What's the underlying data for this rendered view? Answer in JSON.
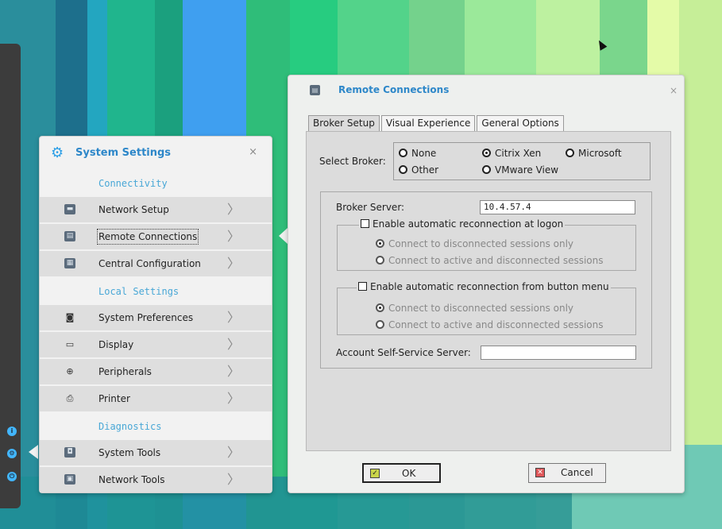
{
  "colors": {
    "accent": "#2d87c9",
    "section_heading": "#48a7d6",
    "panel_bg": "#f2f2f2",
    "menu_item_bg": "#dedede",
    "dock_icon": "#42b6ff"
  },
  "system_settings": {
    "title": "System Settings",
    "close_glyph": "×",
    "sections": [
      {
        "heading": "Connectivity",
        "items": [
          {
            "label": "Network Setup",
            "icon": "network-setup-icon",
            "glyph": "▬",
            "chevron": "〉"
          },
          {
            "label": "Remote Connections",
            "icon": "remote-connections-icon",
            "glyph": "▤",
            "chevron": "〉"
          },
          {
            "label": "Central Configuration",
            "icon": "central-configuration-icon",
            "glyph": "▦",
            "chevron": "〉"
          }
        ]
      },
      {
        "heading": "Local Settings",
        "items": [
          {
            "label": "System Preferences",
            "icon": "system-preferences-icon",
            "glyph": "◙",
            "chevron": "〉"
          },
          {
            "label": "Display",
            "icon": "display-icon",
            "glyph": "▭",
            "chevron": "〉"
          },
          {
            "label": "Peripherals",
            "icon": "mouse-icon",
            "glyph": "⊕",
            "chevron": "〉"
          },
          {
            "label": "Printer",
            "icon": "printer-icon",
            "glyph": "⎙",
            "chevron": "〉"
          }
        ]
      },
      {
        "heading": "Diagnostics",
        "items": [
          {
            "label": "System Tools",
            "icon": "system-tools-icon",
            "glyph": "◘",
            "chevron": "〉"
          },
          {
            "label": "Network Tools",
            "icon": "network-tools-icon",
            "glyph": "▣",
            "chevron": "〉"
          }
        ]
      }
    ]
  },
  "dialog": {
    "title": "Remote Connections",
    "close_glyph": "×",
    "tabs": [
      "Broker Setup",
      "Visual Experience",
      "General Options"
    ],
    "active_tab": "Broker Setup",
    "select_broker_label": "Select Broker:",
    "broker_options": [
      {
        "label": "None",
        "selected": false
      },
      {
        "label": "Citrix Xen",
        "selected": true
      },
      {
        "label": "Microsoft",
        "selected": false
      },
      {
        "label": "Other",
        "selected": false
      },
      {
        "label": "VMware View",
        "selected": false
      }
    ],
    "broker_server_label": "Broker Server:",
    "broker_server_value": "10.4.57.4",
    "group_logon": {
      "checkbox_label": "Enable automatic reconnection at logon",
      "checked": false,
      "options": [
        {
          "label": "Connect to disconnected sessions only",
          "selected": true
        },
        {
          "label": "Connect to active and disconnected sessions",
          "selected": false
        }
      ]
    },
    "group_button": {
      "checkbox_label": "Enable automatic reconnection from button menu",
      "checked": false,
      "options": [
        {
          "label": "Connect to disconnected sessions only",
          "selected": true
        },
        {
          "label": "Connect to active and disconnected sessions",
          "selected": false
        }
      ]
    },
    "account_server_label": "Account Self-Service Server:",
    "account_server_value": "",
    "ok_label": "OK",
    "cancel_label": "Cancel"
  },
  "dock": {
    "icons": [
      {
        "name": "info-icon",
        "glyph": "i"
      },
      {
        "name": "settings-icon",
        "glyph": "⚙"
      },
      {
        "name": "power-icon",
        "glyph": "⏻"
      }
    ]
  }
}
